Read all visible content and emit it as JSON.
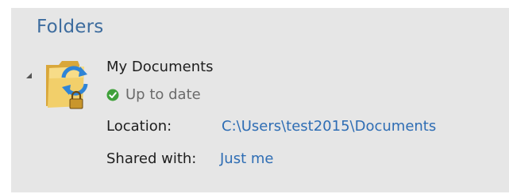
{
  "folders": {
    "title": "Folders",
    "item": {
      "name": "My Documents",
      "status": "Up to date",
      "status_color": "#3fa13a",
      "icon": "shared-folder-sync-lock-icon",
      "location_label": "Location:",
      "location_value": "C:\\Users\\test2015\\Documents",
      "shared_label": "Shared with:",
      "shared_value": "Just me"
    }
  },
  "colors": {
    "title": "#3d6c9e",
    "link": "#2e6db4",
    "panel_bg": "#e6e6e6"
  }
}
